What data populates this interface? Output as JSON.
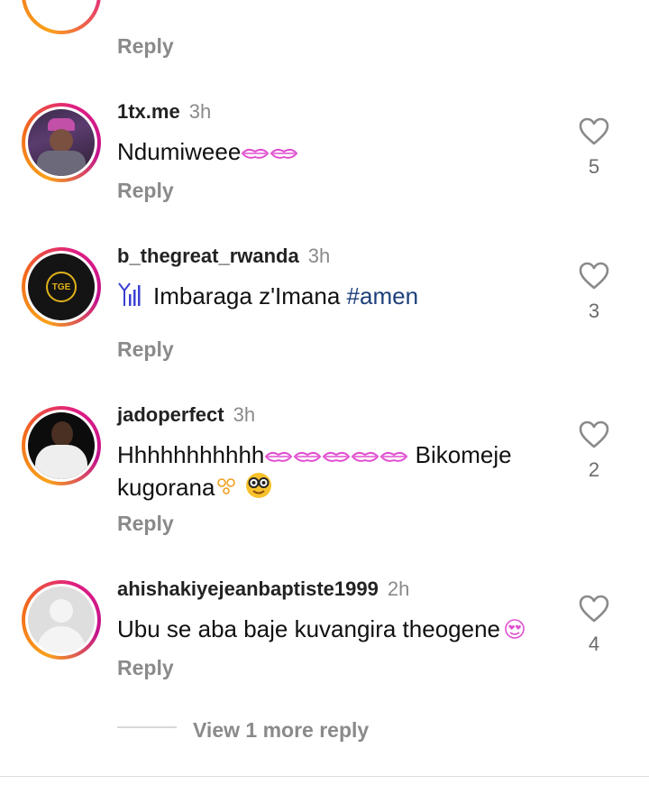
{
  "top_reply": "Reply",
  "comments": [
    {
      "username": "1tx.me",
      "time": "3h",
      "text": "Ndumiweee",
      "reply": "Reply",
      "likes": "5"
    },
    {
      "username": "b_thegreat_rwanda",
      "time": "3h",
      "text": "Imbaraga z'Imana",
      "hashtag": "#amen",
      "reply": "Reply",
      "likes": "3",
      "avatar_logo_text": "TGE"
    },
    {
      "username": "jadoperfect",
      "time": "3h",
      "text_line1": "Hhhhhhhhhhh",
      "text_line1_end": "Bikomeje",
      "text_line2": "kugorana",
      "reply": "Reply",
      "likes": "2"
    },
    {
      "username": "ahishakiyejeanbaptiste1999",
      "time": "2h",
      "text": "Ubu se aba baje kuvangira theogene",
      "reply": "Reply",
      "likes": "4"
    }
  ],
  "view_more": "View 1 more reply",
  "colors": {
    "ring_start": "#f9a11b",
    "ring_end": "#c2138d",
    "hashtag": "#1d3f7a",
    "muted": "#8a8a8a"
  },
  "icons": [
    "heart-icon",
    "kiss-lips-icon",
    "signal-antenna-icon",
    "nerd-face-icon",
    "heart-eyes-icon"
  ]
}
